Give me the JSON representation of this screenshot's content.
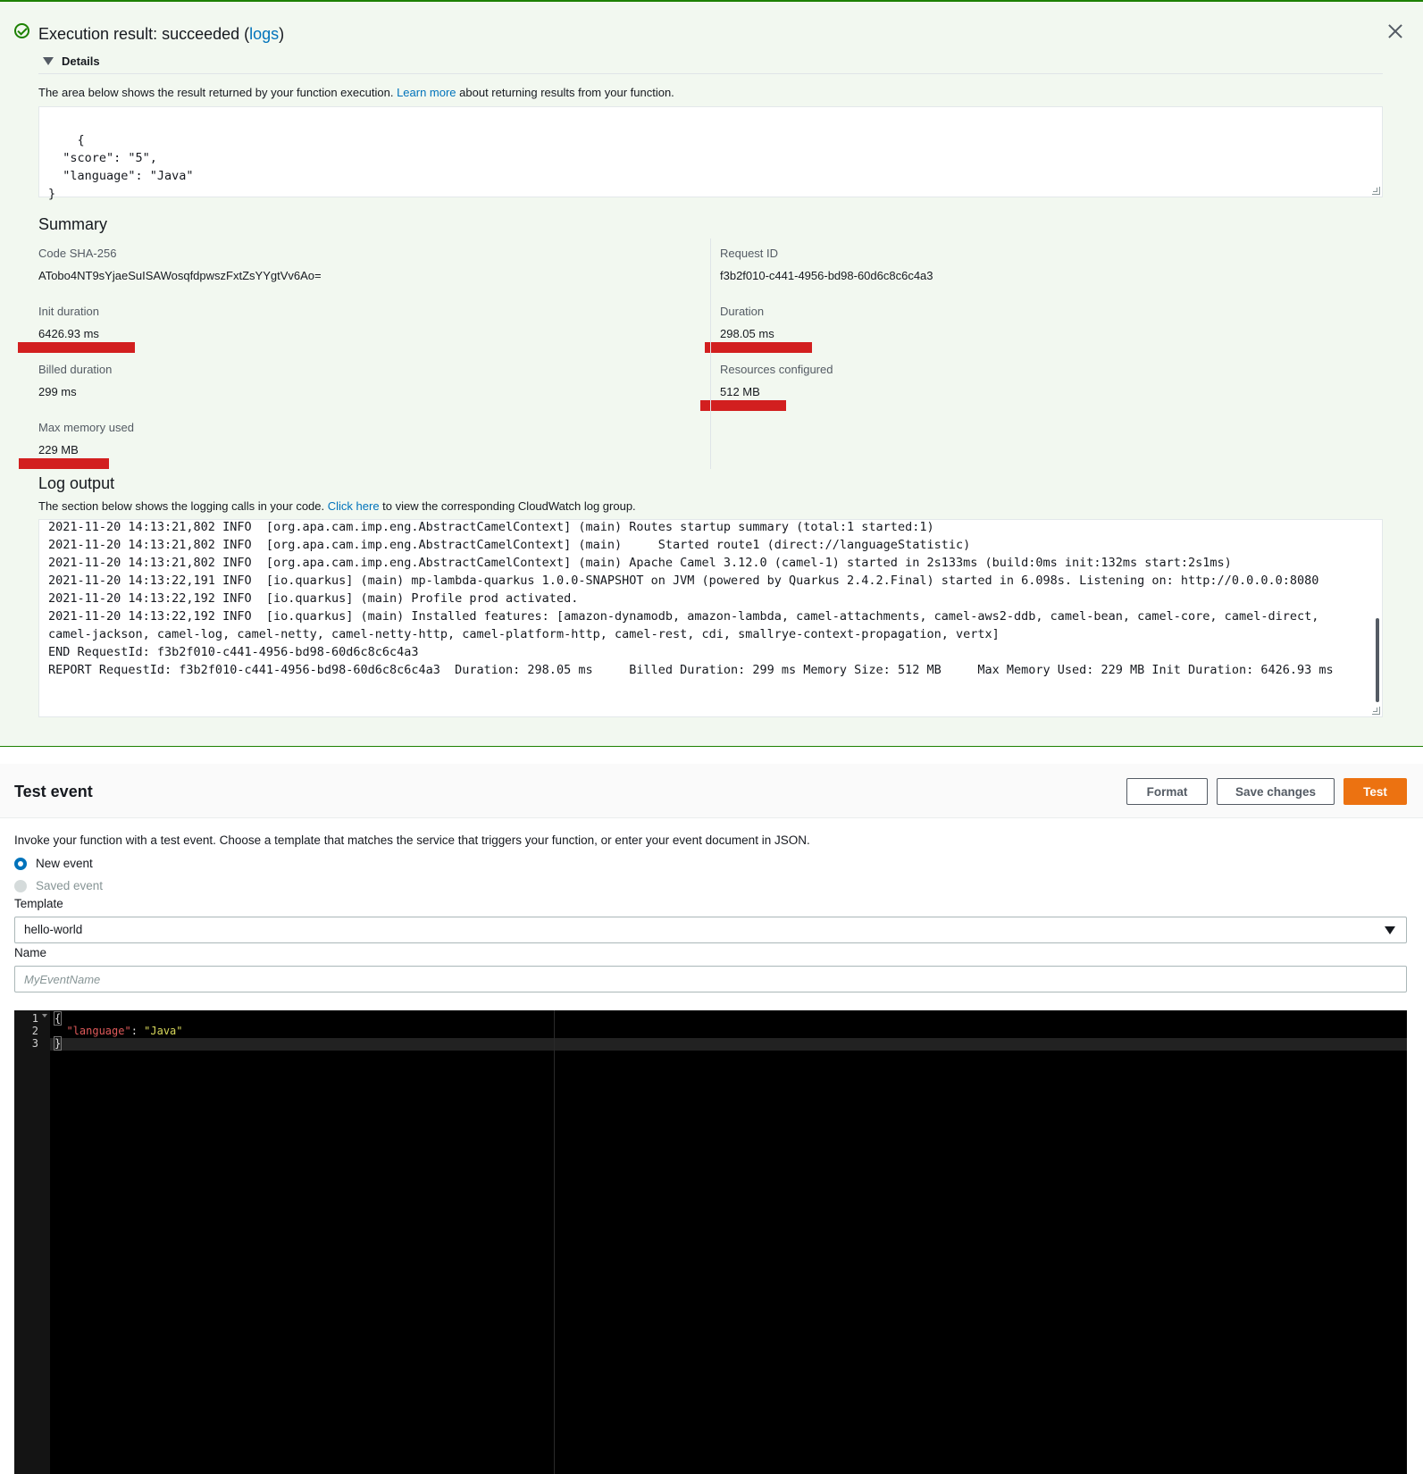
{
  "result": {
    "title_prefix": "Execution result: succeeded (",
    "title_link": "logs",
    "title_suffix": ")",
    "details_label": "Details",
    "description_prefix": "The area below shows the result returned by your function execution. ",
    "description_link": "Learn more",
    "description_suffix": " about returning results from your function.",
    "output": "{\n  \"score\": \"5\",\n  \"language\": \"Java\"\n}"
  },
  "summary": {
    "title": "Summary",
    "code_sha_label": "Code SHA-256",
    "code_sha_value": "ATobo4NT9sYjaeSuISAWosqfdpwszFxtZsYYgtVv6Ao=",
    "request_id_label": "Request ID",
    "request_id_value": "f3b2f010-c441-4956-bd98-60d6c8c6c4a3",
    "init_duration_label": "Init duration",
    "init_duration_value": "6426.93 ms",
    "duration_label": "Duration",
    "duration_value": "298.05 ms",
    "billed_duration_label": "Billed duration",
    "billed_duration_value": "299 ms",
    "resources_label": "Resources configured",
    "resources_value": "512 MB",
    "max_memory_label": "Max memory used",
    "max_memory_value": "229 MB"
  },
  "log": {
    "title": "Log output",
    "description_prefix": "The section below shows the logging calls in your code. ",
    "description_link": "Click here",
    "description_suffix": " to view the corresponding CloudWatch log group.",
    "lines": "2021-11-20 14:13:21,802 INFO  [org.apa.cam.imp.eng.AbstractCamelContext] (main) Routes startup summary (total:1 started:1)\n2021-11-20 14:13:21,802 INFO  [org.apa.cam.imp.eng.AbstractCamelContext] (main)     Started route1 (direct://languageStatistic)\n2021-11-20 14:13:21,802 INFO  [org.apa.cam.imp.eng.AbstractCamelContext] (main) Apache Camel 3.12.0 (camel-1) started in 2s133ms (build:0ms init:132ms start:2s1ms)\n2021-11-20 14:13:22,191 INFO  [io.quarkus] (main) mp-lambda-quarkus 1.0.0-SNAPSHOT on JVM (powered by Quarkus 2.4.2.Final) started in 6.098s. Listening on: http://0.0.0.0:8080\n2021-11-20 14:13:22,192 INFO  [io.quarkus] (main) Profile prod activated.\n2021-11-20 14:13:22,192 INFO  [io.quarkus] (main) Installed features: [amazon-dynamodb, amazon-lambda, camel-attachments, camel-aws2-ddb, camel-bean, camel-core, camel-direct, camel-jackson, camel-log, camel-netty, camel-netty-http, camel-platform-http, camel-rest, cdi, smallrye-context-propagation, vertx]\nEND RequestId: f3b2f010-c441-4956-bd98-60d6c8c6c4a3\nREPORT RequestId: f3b2f010-c441-4956-bd98-60d6c8c6c4a3  Duration: 298.05 ms     Billed Duration: 299 ms Memory Size: 512 MB     Max Memory Used: 229 MB Init Duration: 6426.93 ms"
  },
  "test_event": {
    "title": "Test event",
    "format_label": "Format",
    "save_label": "Save changes",
    "test_label": "Test",
    "description": "Invoke your function with a test event. Choose a template that matches the service that triggers your function, or enter your event document in JSON.",
    "new_event_label": "New event",
    "saved_event_label": "Saved event",
    "template_label": "Template",
    "template_value": "hello-world",
    "name_label": "Name",
    "name_placeholder": "MyEventName",
    "editor": {
      "line_numbers": [
        "1",
        "2",
        "3"
      ],
      "line1": "{",
      "line2_key": "\"language\"",
      "line2_sep": ": ",
      "line2_value": "\"Java\"",
      "line3": "}"
    }
  },
  "colors": {
    "success": "#1d8102",
    "link": "#0073bb",
    "primary_button": "#ec7211",
    "highlight_mark": "#d21f1f"
  }
}
